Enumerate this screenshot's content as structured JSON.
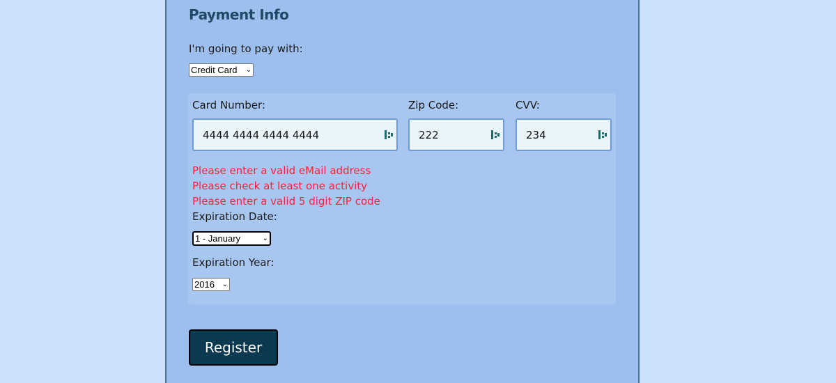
{
  "section": {
    "title": "Payment Info"
  },
  "payment": {
    "label": "I'm going to pay with:",
    "selected": "Credit Card"
  },
  "card": {
    "number_label": "Card Number:",
    "number_value": "4444 4444 4444 4444",
    "zip_label": "Zip Code:",
    "zip_value": "222",
    "cvv_label": "CVV:",
    "cvv_value": "234"
  },
  "errors": [
    "Please enter a valid eMail address",
    "Please check at least one activity",
    "Please enter a valid 5 digit ZIP code"
  ],
  "expiration": {
    "date_label": "Expiration Date:",
    "month_selected": "1 - January",
    "year_label": "Expiration Year:",
    "year_selected": "2016"
  },
  "actions": {
    "register_label": "Register"
  },
  "colors": {
    "page_bg": "#cce0f9",
    "panel_bg": "#9dbfed",
    "error": "#ff1e3c",
    "button_bg": "#0b3a50",
    "heading": "#1e4a66"
  },
  "icons": {
    "input_extension": "keypad-icon",
    "select_arrow": "chevron-down-icon"
  }
}
